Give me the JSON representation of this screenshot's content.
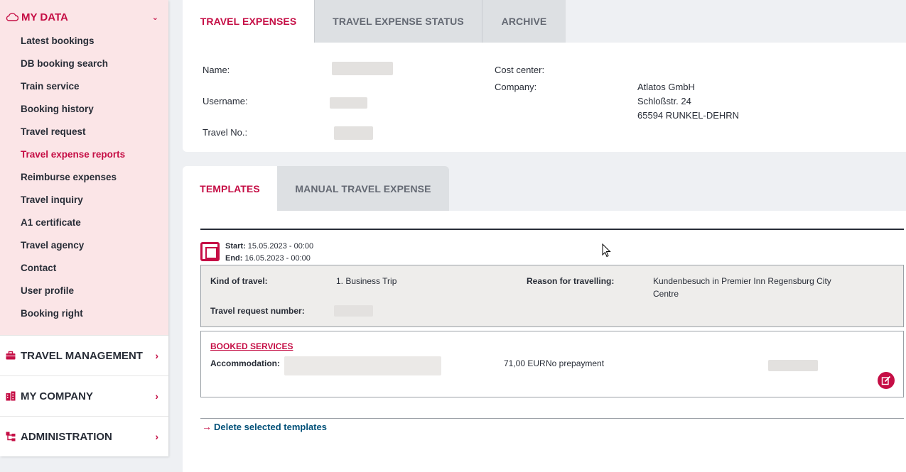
{
  "sidebar": {
    "my_data": {
      "label": "MY DATA",
      "items": [
        {
          "label": "Latest bookings"
        },
        {
          "label": "DB booking search"
        },
        {
          "label": "Train service"
        },
        {
          "label": "Booking history"
        },
        {
          "label": "Travel request"
        },
        {
          "label": "Travel expense reports",
          "active": true
        },
        {
          "label": "Reimburse expenses"
        },
        {
          "label": "Travel inquiry"
        },
        {
          "label": "A1 certificate"
        },
        {
          "label": "Travel agency"
        },
        {
          "label": "Contact"
        },
        {
          "label": "User profile"
        },
        {
          "label": "Booking right"
        }
      ]
    },
    "sections": [
      {
        "label": "TRAVEL MANAGEMENT",
        "icon": "briefcase-icon"
      },
      {
        "label": "MY COMPANY",
        "icon": "building-icon"
      },
      {
        "label": "ADMINISTRATION",
        "icon": "hierarchy-icon"
      }
    ]
  },
  "top_tabs": [
    {
      "label": "TRAVEL EXPENSES",
      "active": true
    },
    {
      "label": "TRAVEL EXPENSE STATUS"
    },
    {
      "label": "ARCHIVE"
    }
  ],
  "info": {
    "name_label": "Name:",
    "username_label": "Username:",
    "travel_no_label": "Travel No.:",
    "cost_center_label": "Cost center:",
    "company_label": "Company:",
    "company_name": "Atlatos GmbH",
    "company_street": "Schloßstr. 24",
    "company_city": "65594 RUNKEL-DEHRN"
  },
  "mid_tabs": [
    {
      "label": "TEMPLATES",
      "active": true
    },
    {
      "label": "MANUAL TRAVEL EXPENSE"
    }
  ],
  "template": {
    "start_label": "Start:",
    "start_value": "15.05.2023 - 00:00",
    "end_label": "End:",
    "end_value": "16.05.2023 - 00:00",
    "kind_label": "Kind of travel:",
    "kind_value": "1. Business Trip",
    "reason_label": "Reason for travelling:",
    "reason_value_line1": "Kundenbesuch in Premier Inn Regensburg City",
    "reason_value_line2": "Centre",
    "request_label": "Travel request number:",
    "booked_services_label": "BOOKED SERVICES",
    "accommodation_label": "Accommodation:",
    "accommodation_price": "71,00 EUR",
    "accommodation_payment": "No prepayment"
  },
  "actions": {
    "delete_label": "Delete selected templates"
  },
  "colors": {
    "accent": "#c50e45",
    "link": "#005078",
    "sidebar_bg": "#fbe5e7"
  }
}
